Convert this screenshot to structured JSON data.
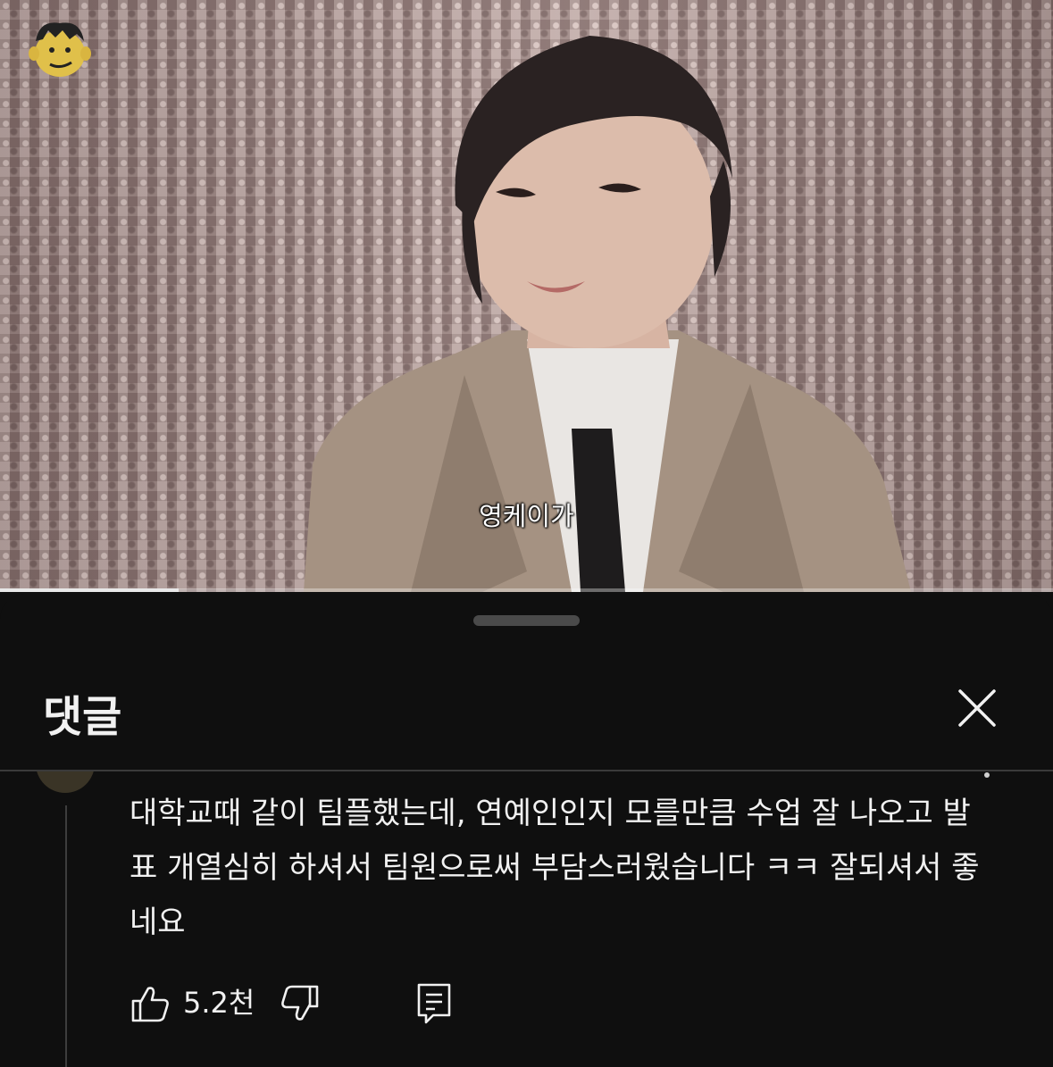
{
  "video": {
    "subtitle": "영케이가",
    "progress_fraction": 0.17,
    "channel_logo": "cartoon-face-logo"
  },
  "comments_sheet": {
    "title": "댓글",
    "close_icon": "close-icon"
  },
  "comment": {
    "text": "대학교때 같이 팀플했는데, 연예인인지 모를만큼 수업 잘 나오고 발표 개열심히 하셔서 팀원으로써 부담스러웠습니다 ㅋㅋ 잘되셔서 좋네요",
    "like_count": "5.2천",
    "icons": [
      "thumbs-up-icon",
      "thumbs-down-icon",
      "reply-icon"
    ]
  },
  "colors": {
    "background": "#0f0f0f",
    "text": "#f1f1f1",
    "divider": "#3a3a3a"
  }
}
